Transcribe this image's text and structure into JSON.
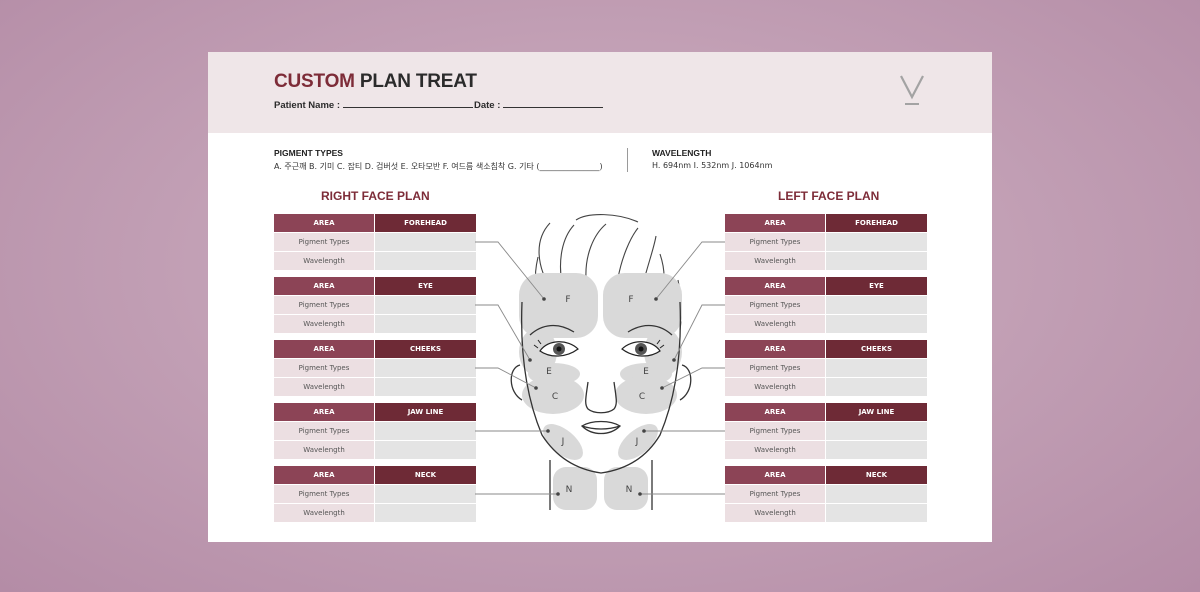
{
  "header": {
    "title_accent": "CUSTOM",
    "title_rest": " PLAN TREAT",
    "patient_label": "Patient Name :",
    "date_label": "Date :",
    "logo_letter": "V"
  },
  "info": {
    "pigment_label": "PIGMENT TYPES",
    "pigment_options": "A. 주근깨   B. 기미   C. 잡티   D. 검버섯   E. 오타모반   F. 여드름 색소침착   G. 기타 (_______________)",
    "wavelength_label": "WAVELENGTH",
    "wavelength_options": "H. 694nm   I. 532nm   J. 1064nm"
  },
  "right_plan": {
    "title": "RIGHT FACE PLAN",
    "tables": [
      {
        "area_label": "AREA",
        "area": "FOREHEAD",
        "pigment_label": "Pigment Types",
        "wavelength_label": "Wavelength"
      },
      {
        "area_label": "AREA",
        "area": "EYE",
        "pigment_label": "Pigment Types",
        "wavelength_label": "Wavelength"
      },
      {
        "area_label": "AREA",
        "area": "CHEEKS",
        "pigment_label": "Pigment Types",
        "wavelength_label": "Wavelength"
      },
      {
        "area_label": "AREA",
        "area": "JAW LINE",
        "pigment_label": "Pigment Types",
        "wavelength_label": "Wavelength"
      },
      {
        "area_label": "AREA",
        "area": "NECK",
        "pigment_label": "Pigment Types",
        "wavelength_label": "Wavelength"
      }
    ]
  },
  "left_plan": {
    "title": "LEFT FACE PLAN",
    "tables": [
      {
        "area_label": "AREA",
        "area": "FOREHEAD",
        "pigment_label": "Pigment Types",
        "wavelength_label": "Wavelength"
      },
      {
        "area_label": "AREA",
        "area": "EYE",
        "pigment_label": "Pigment Types",
        "wavelength_label": "Wavelength"
      },
      {
        "area_label": "AREA",
        "area": "CHEEKS",
        "pigment_label": "Pigment Types",
        "wavelength_label": "Wavelength"
      },
      {
        "area_label": "AREA",
        "area": "JAW LINE",
        "pigment_label": "Pigment Types",
        "wavelength_label": "Wavelength"
      },
      {
        "area_label": "AREA",
        "area": "NECK",
        "pigment_label": "Pigment Types",
        "wavelength_label": "Wavelength"
      }
    ]
  },
  "face_labels": {
    "forehead": "F",
    "eye": "E",
    "cheeks": "C",
    "jaw": "J",
    "neck": "N"
  },
  "colors": {
    "accent": "#7d2c38",
    "header_bg": "#efe6e8",
    "area_label_bg": "#8c4456",
    "area_value_bg": "#6e2a36",
    "row_label_bg": "#ecdfe2",
    "row_value_bg": "#e4e4e4",
    "zone_fill": "#d9d9d9"
  }
}
